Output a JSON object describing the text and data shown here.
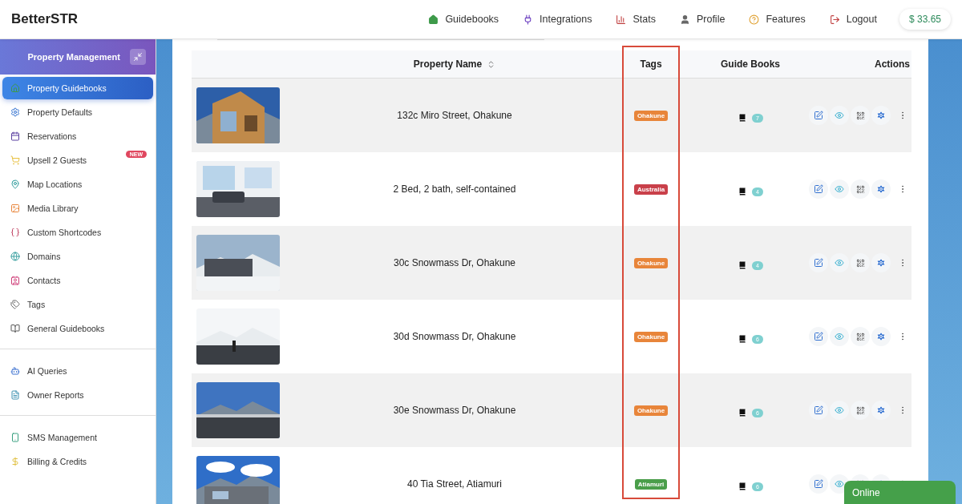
{
  "brand": "BetterSTR",
  "nav": [
    {
      "label": "Guidebooks"
    },
    {
      "label": "Integrations"
    },
    {
      "label": "Stats"
    },
    {
      "label": "Profile"
    },
    {
      "label": "Features"
    },
    {
      "label": "Logout"
    }
  ],
  "balance": "$ 33.65",
  "sidebar": {
    "title": "Property Management",
    "sections": [
      [
        {
          "label": "Property Guidebooks",
          "selected": true
        },
        {
          "label": "Property Defaults",
          "selected": false
        },
        {
          "label": "Reservations",
          "selected": false
        },
        {
          "label": "Upsell 2 Guests",
          "selected": false,
          "badge": "NEW"
        },
        {
          "label": "Map Locations",
          "selected": false
        },
        {
          "label": "Media Library",
          "selected": false
        },
        {
          "label": "Custom Shortcodes",
          "selected": false
        },
        {
          "label": "Domains",
          "selected": false
        },
        {
          "label": "Contacts",
          "selected": false
        },
        {
          "label": "Tags",
          "selected": false
        },
        {
          "label": "General Guidebooks",
          "selected": false
        }
      ],
      [
        {
          "label": "AI Queries",
          "selected": false
        },
        {
          "label": "Owner Reports",
          "selected": false
        }
      ],
      [
        {
          "label": "SMS Management",
          "selected": false
        },
        {
          "label": "Billing & Credits",
          "selected": false
        }
      ]
    ]
  },
  "table": {
    "columns": [
      "Property Name",
      "Tags",
      "Guide Books",
      "Actions"
    ],
    "rows": [
      {
        "name": "132c Miro Street, Ohakune",
        "tag": {
          "label": "Ohakune",
          "color": "#e8853a"
        },
        "guidebooks": "7"
      },
      {
        "name": "2 Bed, 2 bath, self-contained",
        "tag": {
          "label": "Australia",
          "color": "#c9404a"
        },
        "guidebooks": "4"
      },
      {
        "name": "30c Snowmass Dr, Ohakune",
        "tag": {
          "label": "Ohakune",
          "color": "#e8853a"
        },
        "guidebooks": "4"
      },
      {
        "name": "30d Snowmass Dr, Ohakune",
        "tag": {
          "label": "Ohakune",
          "color": "#e8853a"
        },
        "guidebooks": "6"
      },
      {
        "name": "30e Snowmass Dr, Ohakune",
        "tag": {
          "label": "Ohakune",
          "color": "#e8853a"
        },
        "guidebooks": "6"
      },
      {
        "name": "40 Tia Street, Atiamuri",
        "tag": {
          "label": "Atiamuri",
          "color": "#4a9e4a"
        },
        "guidebooks": "6"
      }
    ]
  },
  "status": "Online"
}
